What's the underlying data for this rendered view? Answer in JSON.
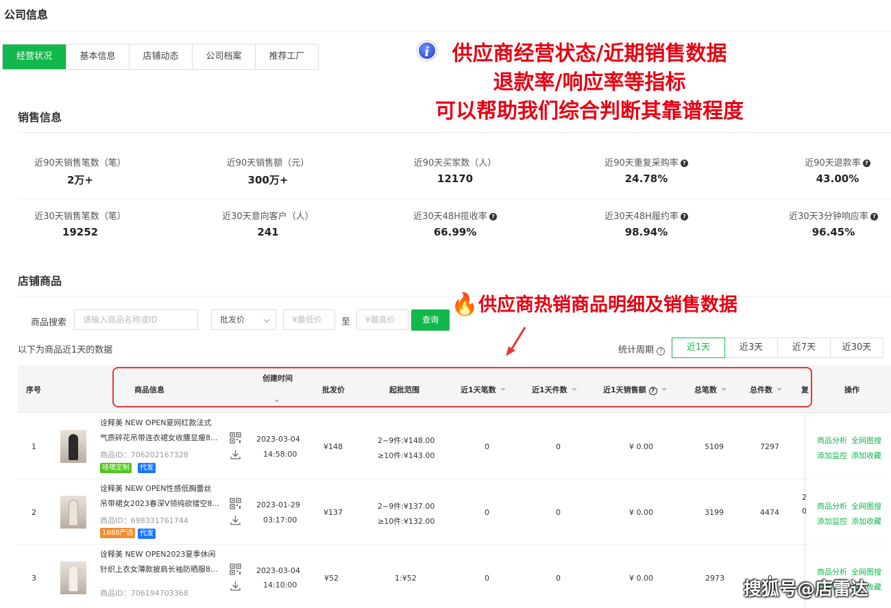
{
  "page_title": "公司信息",
  "tabs": [
    "经营状况",
    "基本信息",
    "店铺动态",
    "公司档案",
    "推荐工厂"
  ],
  "annotations": {
    "main_lines": [
      "供应商经营状态/近期销售数据",
      "退款率/响应率等指标",
      "可以帮助我们综合判断其靠谱程度"
    ],
    "hot": "供应商热销商品明细及销售数据"
  },
  "sales": {
    "title": "销售信息",
    "row1": [
      {
        "label": "近90天销售笔数（笔）",
        "value": "2万+",
        "help": false
      },
      {
        "label": "近90天销售额（元）",
        "value": "300万+",
        "help": false
      },
      {
        "label": "近90天买家数（人）",
        "value": "12170",
        "help": false
      },
      {
        "label": "近90天重复采购率",
        "value": "24.78%",
        "help": true
      },
      {
        "label": "近90天退款率",
        "value": "43.00%",
        "help": true
      }
    ],
    "row2": [
      {
        "label": "近30天销售笔数（笔）",
        "value": "19252",
        "help": false
      },
      {
        "label": "近30天意向客户（人）",
        "value": "241",
        "help": false
      },
      {
        "label": "近30天48H揽收率",
        "value": "66.99%",
        "help": true
      },
      {
        "label": "近30天48H履约率",
        "value": "98.94%",
        "help": true
      },
      {
        "label": "近30天3分钟响应率",
        "value": "96.45%",
        "help": true
      }
    ]
  },
  "store": {
    "title": "店铺商品",
    "search_label": "商品搜索",
    "search_placeholder": "请输入商品名称或ID",
    "price_type": "批发价",
    "min_placeholder": "¥最低价",
    "to": "至",
    "max_placeholder": "¥最高价",
    "query_label": "查询",
    "data_note": "以下为商品近1天的数据",
    "period_label": "统计周期",
    "periods": [
      "近1天",
      "近3天",
      "近7天",
      "近30天"
    ],
    "active_period": "近1天"
  },
  "table": {
    "headers": {
      "index": "序号",
      "product": "商品信息",
      "created": "创建时间",
      "price": "批发价",
      "range": "起批范围",
      "orders_1d": "近1天笔数",
      "pieces_1d": "近1天件数",
      "sales_1d": "近1天销售额",
      "total_orders": "总笔数",
      "total_pieces": "总件数",
      "extra": "复",
      "ops": "操作"
    },
    "ops_labels": {
      "analysis": "商品分析",
      "image_search": "全网图搜",
      "monitor": "添加监控",
      "favorite": "添加收藏"
    },
    "rows": [
      {
        "index": "1",
        "title_line1": "诠释美 NEW OPEN夏网红款法式",
        "title_line2": "气质碎花吊带连衣裙女收腰显瘦8...",
        "pid": "商品ID：706202167328",
        "badges": [
          {
            "text": "哇噢定制",
            "color": "#52c41a"
          },
          {
            "text": "代发",
            "color": "#1677ff"
          }
        ],
        "date": "2023-03-04",
        "time": "14:58:00",
        "price": "¥148",
        "range1": "2~9件:¥148.00",
        "range2": "≥10件:¥143.00",
        "orders_1d": "0",
        "pieces_1d": "0",
        "sales_1d": "¥ 0.00",
        "total_orders": "5109",
        "total_pieces": "7297",
        "extra1": "",
        "extra2": ""
      },
      {
        "index": "2",
        "title_line1": "诠释美 NEW OPEN性感低胸蕾丝",
        "title_line2": "吊带裙女2023春深V领纯欲镂空8...",
        "pid": "商品ID：698331761744",
        "badges": [
          {
            "text": "1688严选",
            "color": "#f08c2b"
          },
          {
            "text": "代发",
            "color": "#1677ff"
          }
        ],
        "date": "2023-01-29",
        "time": "03:17:00",
        "price": "¥137",
        "range1": "2~9件:¥137.00",
        "range2": "≥10件:¥132.00",
        "orders_1d": "0",
        "pieces_1d": "0",
        "sales_1d": "¥ 0.00",
        "total_orders": "3199",
        "total_pieces": "4474",
        "extra1": "2",
        "extra2": "0"
      },
      {
        "index": "3",
        "title_line1": "诠释美 NEW OPEN2023夏季休闲",
        "title_line2": "针织上衣女薄款披肩长袖防晒服8...",
        "pid": "商品ID：706194703368",
        "badges": [],
        "date": "2023-03-04",
        "time": "14:10:00",
        "price": "¥52",
        "range1": "1:¥52",
        "range2": "",
        "orders_1d": "0",
        "pieces_1d": "0",
        "sales_1d": "¥ 0.00",
        "total_orders": "2973",
        "total_pieces": "0",
        "extra1": "",
        "extra2": ""
      }
    ]
  },
  "watermark": "搜狐号@店雷达",
  "colors": {
    "accent": "#12b84c",
    "annotation": "#e60012",
    "highlight_box": "#e33333"
  }
}
